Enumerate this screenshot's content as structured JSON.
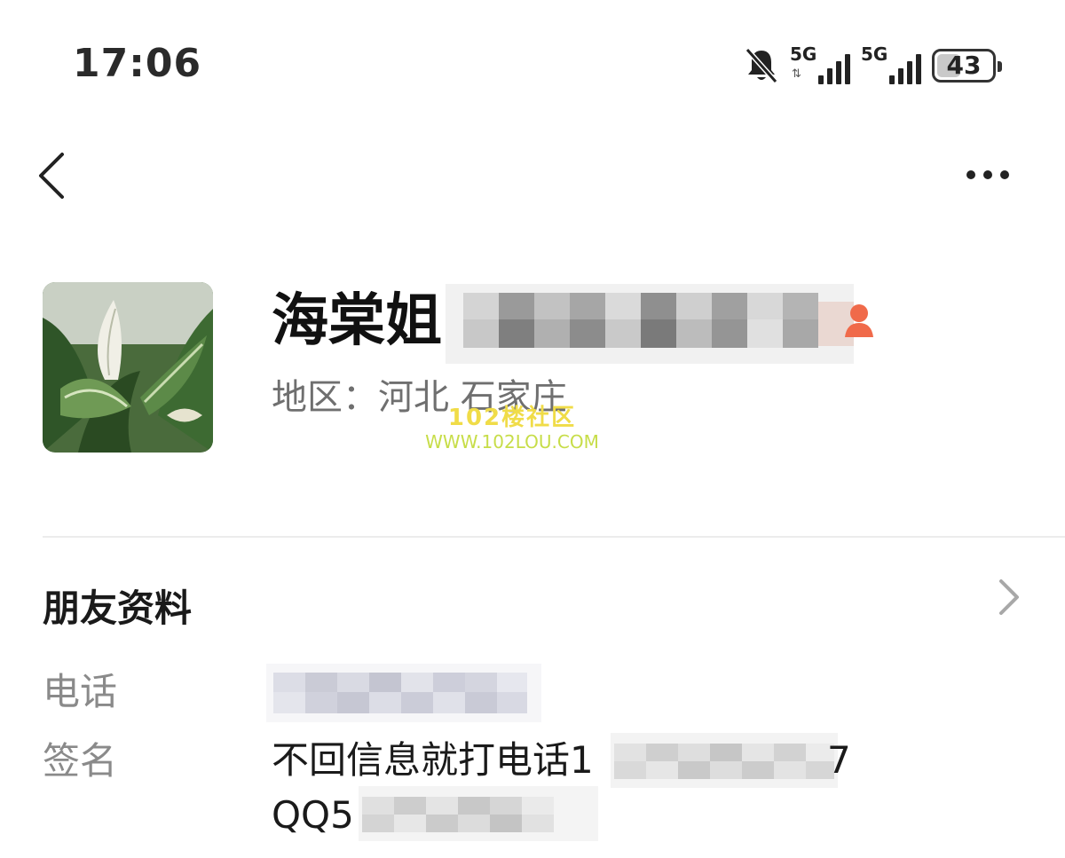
{
  "status_bar": {
    "time": "17:06",
    "network1": "5G",
    "network2": "5G",
    "battery_level": "43",
    "battery_fraction": 0.43,
    "icons": [
      "bell-muted-icon",
      "signal-5g-icon",
      "signal-5g-icon",
      "battery-icon"
    ]
  },
  "nav": {
    "back_icon": "chevron-left-icon",
    "more_icon": "more-dots-icon"
  },
  "profile": {
    "name": "海棠姐1",
    "region": "地区：河北 石家庄",
    "gender_icon": "female-icon",
    "gender_color": "#f06a4a"
  },
  "watermark": {
    "title": "102楼社区",
    "url": "WWW.102LOU.COM"
  },
  "friend_info": {
    "title": "朋友资料",
    "phone_label": "电话",
    "signature_label": "签名",
    "signature_line1": "不回信息就打电话1",
    "signature_line1_end": "7",
    "signature_line2": "QQ5"
  }
}
